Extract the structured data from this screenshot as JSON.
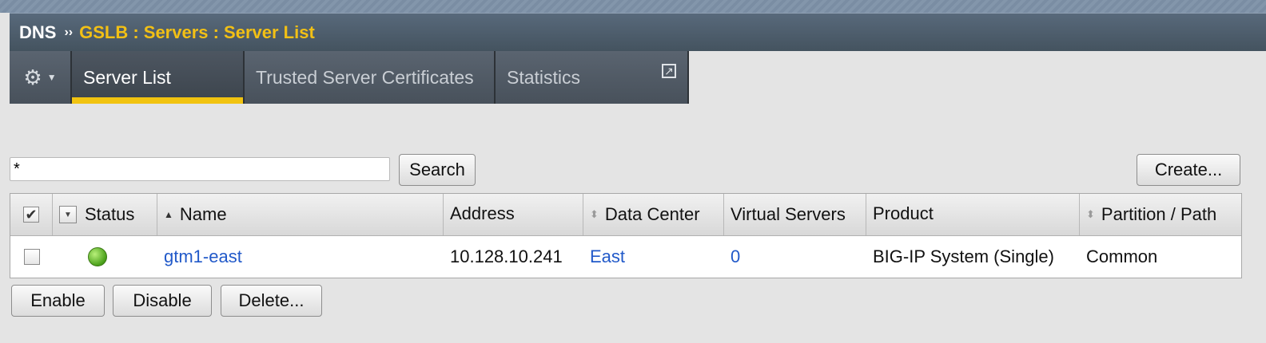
{
  "header": {
    "section": "DNS",
    "separator": "››",
    "path": "GSLB : Servers : Server List"
  },
  "tabs": {
    "gear_icon": "gear-icon",
    "items": [
      {
        "label": "Server List",
        "active": true
      },
      {
        "label": "Trusted Server Certificates",
        "active": false
      },
      {
        "label": "Statistics",
        "active": false,
        "icon": "external-link-icon"
      }
    ]
  },
  "toolbar": {
    "search_value": "*",
    "search_button": "Search",
    "create_button": "Create..."
  },
  "table": {
    "columns": {
      "status": "Status",
      "name": "Name",
      "address": "Address",
      "data_center": "Data Center",
      "virtual_servers": "Virtual Servers",
      "product": "Product",
      "partition": "Partition / Path"
    },
    "rows": [
      {
        "status": "green",
        "name": "gtm1-east",
        "address": "10.128.10.241",
        "data_center": "East",
        "virtual_servers": "0",
        "product": "BIG-IP System (Single)",
        "partition": "Common"
      }
    ]
  },
  "actions": {
    "enable": "Enable",
    "disable": "Disable",
    "delete": "Delete..."
  },
  "colors": {
    "accent": "#f1c310",
    "link": "#2159c9",
    "status_available": "#4aa01a"
  }
}
